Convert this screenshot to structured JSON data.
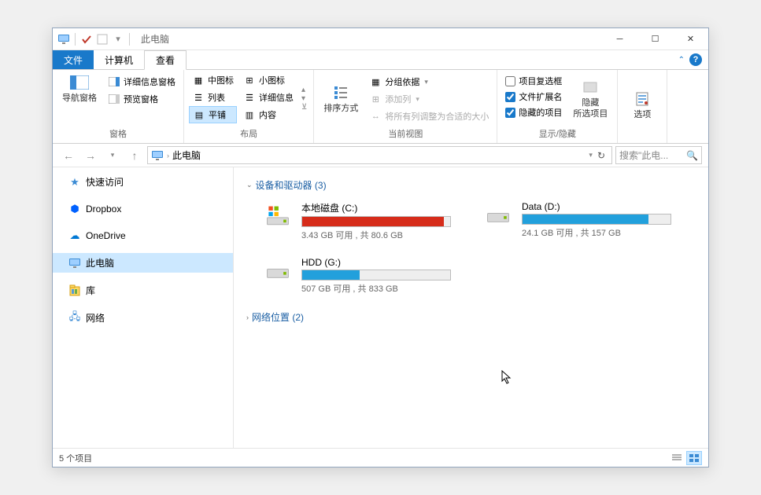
{
  "window": {
    "title": "此电脑"
  },
  "tabs": {
    "file": "文件",
    "computer": "计算机",
    "view": "查看"
  },
  "ribbon": {
    "panes": {
      "label": "窗格",
      "nav": "导航窗格",
      "preview": "预览窗格",
      "detailspane": "详细信息窗格"
    },
    "layout": {
      "label": "布局",
      "medium_icons": "中图标",
      "small_icons": "小图标",
      "list": "列表",
      "details": "详细信息",
      "tiles": "平铺",
      "content": "内容"
    },
    "current": {
      "label": "当前视图",
      "sort": "排序方式",
      "group_by": "分组依据",
      "add_columns": "添加列",
      "size_columns": "将所有列调整为合适的大小"
    },
    "showhide": {
      "label": "显示/隐藏",
      "item_checkboxes": "项目复选框",
      "file_ext": "文件扩展名",
      "hidden_items": "隐藏的项目",
      "hide": "隐藏",
      "hide_sub": "所选项目"
    },
    "options": {
      "label": "选项"
    }
  },
  "addr": {
    "location": "此电脑",
    "search_placeholder": "搜索\"此电..."
  },
  "sidebar": {
    "quick": "快速访问",
    "dropbox": "Dropbox",
    "onedrive": "OneDrive",
    "thispc": "此电脑",
    "libraries": "库",
    "network": "网络"
  },
  "sections": {
    "devices": {
      "title": "设备和驱动器",
      "count": 3
    },
    "network": {
      "title": "网络位置",
      "count": 2
    }
  },
  "drives": [
    {
      "name": "本地磁盘 (C:)",
      "free": "3.43 GB",
      "total": "80.6 GB",
      "fill_pct": 96,
      "color": "#d62c1a",
      "type": "system"
    },
    {
      "name": "Data (D:)",
      "free": "24.1 GB",
      "total": "157 GB",
      "fill_pct": 85,
      "color": "#22a0dc",
      "type": "disk"
    },
    {
      "name": "HDD (G:)",
      "free": "507 GB",
      "total": "833 GB",
      "fill_pct": 39,
      "color": "#22a0dc",
      "type": "disk"
    }
  ],
  "status": {
    "items": "5 个项目"
  },
  "strings": {
    "free_sep": " 可用 , 共 "
  }
}
